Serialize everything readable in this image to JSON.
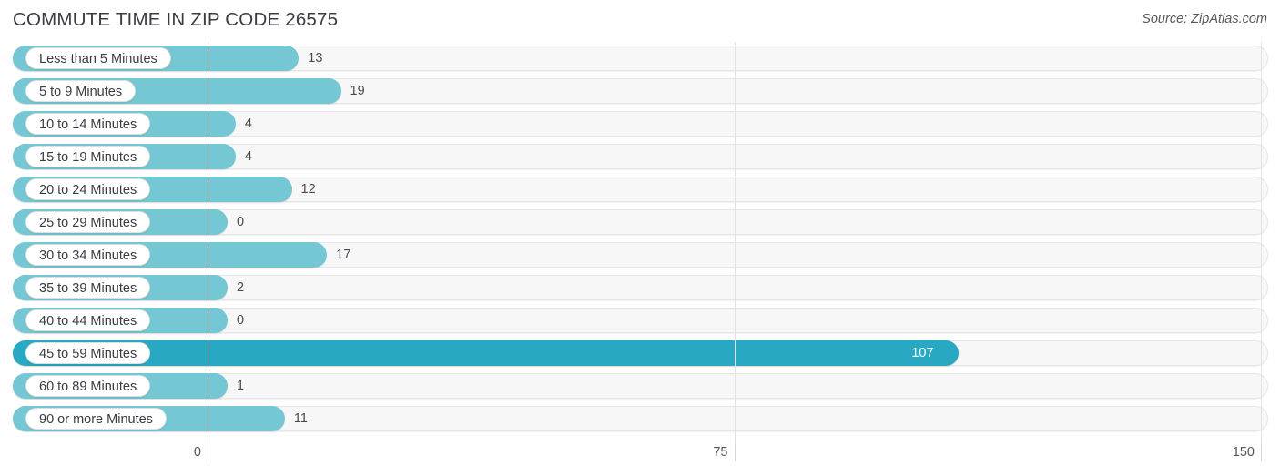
{
  "header": {
    "title": "COMMUTE TIME IN ZIP CODE 26575",
    "source": "Source: ZipAtlas.com"
  },
  "colors": {
    "bar": "#76c7d4",
    "bar_highlight": "#29a8c4",
    "track": "#f7f7f7",
    "text": "#3a3a42"
  },
  "chart_data": {
    "type": "bar",
    "orientation": "horizontal",
    "title": "COMMUTE TIME IN ZIP CODE 26575",
    "xlabel": "",
    "ylabel": "",
    "xlim": [
      0,
      150
    ],
    "ticks": [
      {
        "label": "0",
        "value": 0
      },
      {
        "label": "75",
        "value": 75
      },
      {
        "label": "150",
        "value": 150
      }
    ],
    "grid": true,
    "legend": "none",
    "categories": [
      "Less than 5 Minutes",
      "5 to 9 Minutes",
      "10 to 14 Minutes",
      "15 to 19 Minutes",
      "20 to 24 Minutes",
      "25 to 29 Minutes",
      "30 to 34 Minutes",
      "35 to 39 Minutes",
      "40 to 44 Minutes",
      "45 to 59 Minutes",
      "60 to 89 Minutes",
      "90 or more Minutes"
    ],
    "values": [
      13,
      19,
      4,
      4,
      12,
      0,
      17,
      2,
      0,
      107,
      1,
      11
    ],
    "value_labels": [
      "13",
      "19",
      "4",
      "4",
      "12",
      "0",
      "17",
      "2",
      "0",
      "107",
      "1",
      "11"
    ],
    "highlight_index": 9,
    "max_value": 107
  }
}
